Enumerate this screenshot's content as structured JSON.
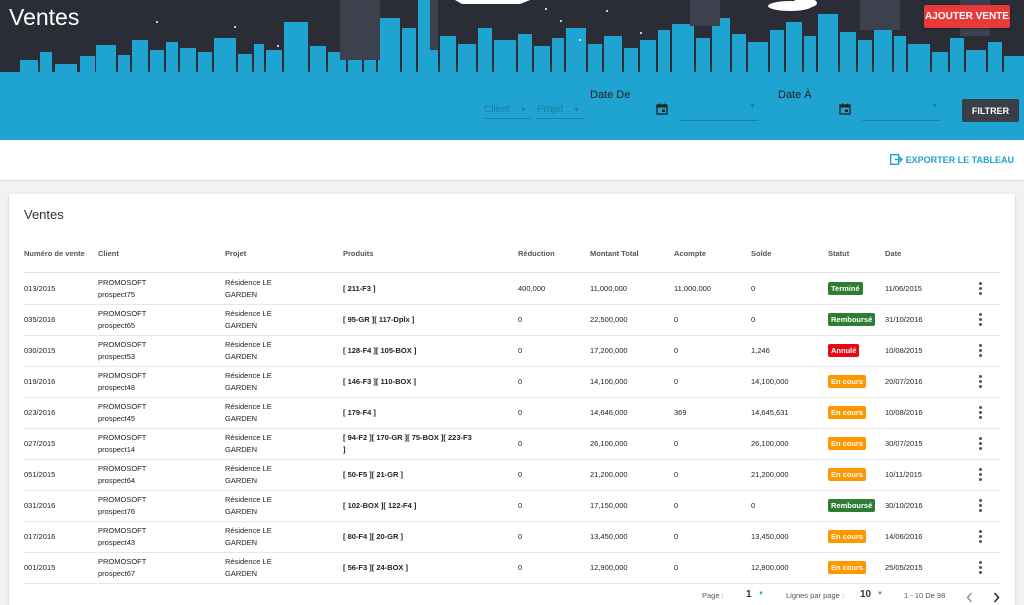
{
  "header": {
    "title": "Ventes",
    "add_button": "AJOUTER VENTE",
    "client_placeholder": "Client",
    "projet_placeholder": "Projet",
    "date_from_label": "Date De",
    "date_to_label": "Date À",
    "filter_button": "FILTRER"
  },
  "toolbar": {
    "export_label": "EXPORTER LE TABLEAU"
  },
  "card": {
    "title": "Ventes"
  },
  "columns": [
    "Numéro de vente",
    "Client",
    "Projet",
    "Produits",
    "Réduction",
    "Montant Total",
    "Acompte",
    "Solde",
    "Statut",
    "Date"
  ],
  "rows": [
    {
      "num": "013/2015",
      "client1": "PROMOSOFT",
      "client2": "prospect75",
      "projet1": "Résidence LE",
      "projet2": "GARDEN",
      "produits1": "[ 211-F3 ]",
      "produits2": "",
      "reduction": "400,000",
      "total": "11,000,000",
      "acompte": "11,000,000",
      "solde": "0",
      "statut": "Terminé",
      "color": "#2e7d32",
      "date": "11/06/2015"
    },
    {
      "num": "035/2016",
      "client1": "PROMOSOFT",
      "client2": "prospect65",
      "projet1": "Résidence LE",
      "projet2": "GARDEN",
      "produits1": "[ 95-GR ][ 117-Dplx ]",
      "produits2": "",
      "reduction": "0",
      "total": "22,500,000",
      "acompte": "0",
      "solde": "0",
      "statut": "Remboursé",
      "color": "#2e7d32",
      "date": "31/10/2016"
    },
    {
      "num": "030/2015",
      "client1": "PROMOSOFT",
      "client2": "prospect53",
      "projet1": "Résidence LE",
      "projet2": "GARDEN",
      "produits1": "[ 128-F4 ][ 105-BOX ]",
      "produits2": "",
      "reduction": "0",
      "total": "17,200,000",
      "acompte": "0",
      "solde": "1,246",
      "statut": "Annulé",
      "color": "#e50914",
      "date": "10/08/2015"
    },
    {
      "num": "019/2016",
      "client1": "PROMOSOFT",
      "client2": "prospect48",
      "projet1": "Résidence LE",
      "projet2": "GARDEN",
      "produits1": "[ 146-F3 ][ 110-BOX ]",
      "produits2": "",
      "reduction": "0",
      "total": "14,100,000",
      "acompte": "0",
      "solde": "14,100,000",
      "statut": "En cours",
      "color": "#ff9800",
      "date": "20/07/2016"
    },
    {
      "num": "023/2016",
      "client1": "PROMOSOFT",
      "client2": "prospect45",
      "projet1": "Résidence LE",
      "projet2": "GARDEN",
      "produits1": "[ 179-F4 ]",
      "produits2": "",
      "reduction": "0",
      "total": "14,646,000",
      "acompte": "369",
      "solde": "14,645,631",
      "statut": "En cours",
      "color": "#ff9800",
      "date": "10/08/2016"
    },
    {
      "num": "027/2015",
      "client1": "PROMOSOFT",
      "client2": "prospect14",
      "projet1": "Résidence LE",
      "projet2": "GARDEN",
      "produits1": "[ 94-F2 ][ 170-GR ][ 75-BOX ][ 223-F3",
      "produits2": "]",
      "reduction": "0",
      "total": "26,100,000",
      "acompte": "0",
      "solde": "26,100,000",
      "statut": "En cours",
      "color": "#ff9800",
      "date": "30/07/2015"
    },
    {
      "num": "051/2015",
      "client1": "PROMOSOFT",
      "client2": "prospect64",
      "projet1": "Résidence LE",
      "projet2": "GARDEN",
      "produits1": "[ 50-F5 ][ 21-GR ]",
      "produits2": "",
      "reduction": "0",
      "total": "21,200,000",
      "acompte": "0",
      "solde": "21,200,000",
      "statut": "En cours",
      "color": "#ff9800",
      "date": "10/11/2015"
    },
    {
      "num": "031/2016",
      "client1": "PROMOSOFT",
      "client2": "prospect76",
      "projet1": "Résidence LE",
      "projet2": "GARDEN",
      "produits1": "[ 102-BOX ][ 122-F4 ]",
      "produits2": "",
      "reduction": "0",
      "total": "17,150,000",
      "acompte": "0",
      "solde": "0",
      "statut": "Remboursé",
      "color": "#2e7d32",
      "date": "30/10/2016"
    },
    {
      "num": "017/2016",
      "client1": "PROMOSOFT",
      "client2": "prospect43",
      "projet1": "Résidence LE",
      "projet2": "GARDEN",
      "produits1": "[ 80-F4 ][ 20-GR ]",
      "produits2": "",
      "reduction": "0",
      "total": "13,450,000",
      "acompte": "0",
      "solde": "13,450,000",
      "statut": "En cours",
      "color": "#ff9800",
      "date": "14/06/2016"
    },
    {
      "num": "001/2015",
      "client1": "PROMOSOFT",
      "client2": "prospect67",
      "projet1": "Résidence LE",
      "projet2": "GARDEN",
      "produits1": "[ 56-F3 ][ 24-BOX ]",
      "produits2": "",
      "reduction": "0",
      "total": "12,900,000",
      "acompte": "0",
      "solde": "12,900,000",
      "statut": "En cours",
      "color": "#ff9800",
      "date": "25/05/2015"
    }
  ],
  "pagination": {
    "page_label": "Page :",
    "page_value": "1",
    "rows_label": "Lignes par page :",
    "rows_value": "10",
    "range": "1 - 10 De 98"
  }
}
